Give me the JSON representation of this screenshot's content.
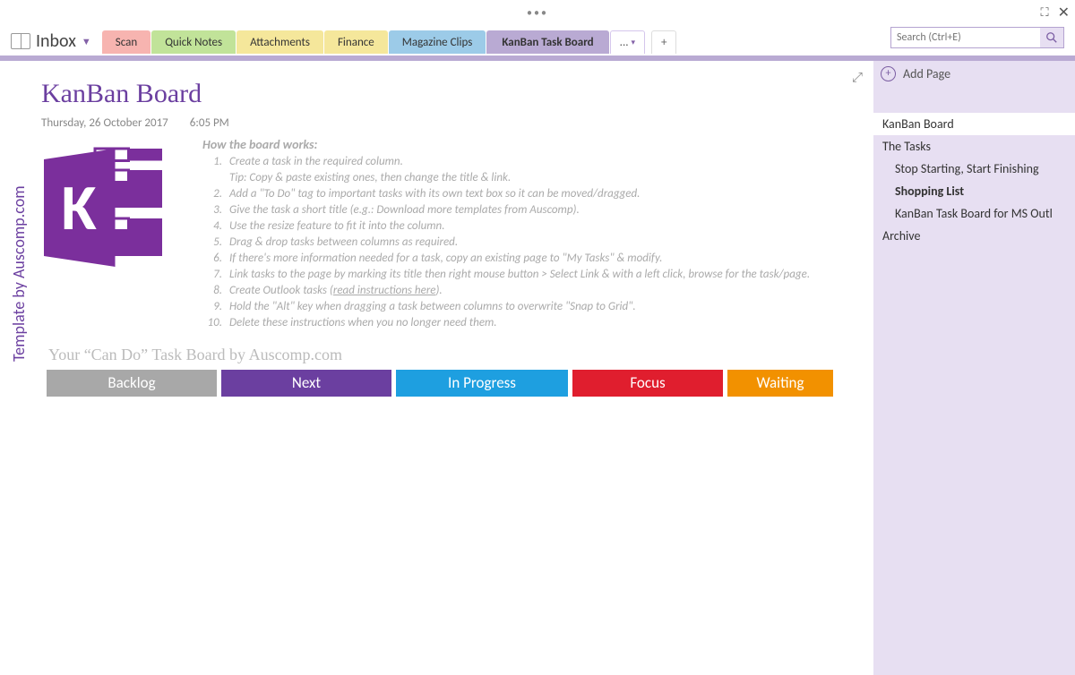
{
  "titlebar": {
    "dots": "•••"
  },
  "notebook": {
    "name": "Inbox"
  },
  "tabs": {
    "scan": "Scan",
    "quicknotes": "Quick Notes",
    "attachments": "Attachments",
    "finance": "Finance",
    "magazine": "Magazine Clips",
    "kanban": "KanBan Task Board",
    "more": "...",
    "new": "+"
  },
  "search": {
    "placeholder": "Search (Ctrl+E)"
  },
  "side_credit": "Template by Auscomp.com",
  "page": {
    "title": "KanBan Board",
    "date": "Thursday, 26 October 2017",
    "time": "6:05 PM"
  },
  "how_works": {
    "title": "How the board works:",
    "items": [
      "Create a task in the required column.",
      "Add a \"To Do\" tag to important tasks with its own text box so it can be moved/dragged.",
      "Give the task a short title (e.g.: Download more templates from Auscomp).",
      "Use the resize feature to fit it into the column.",
      "Drag & drop tasks between columns as required.",
      "If there's more information needed for a task, copy an existing page to \"My Tasks\" & modify.",
      "Link tasks to the page by marking its title then right mouse button > Select Link & with a left click, browse for the task/page.",
      "Create Outlook tasks (",
      "Hold the \"Alt\" key when dragging a task between columns to overwrite \"Snap to Grid\".",
      "Delete these instructions when you no longer need them."
    ],
    "tip": "Tip: Copy & paste existing ones, then change the title & link.",
    "read_link": "read instructions here",
    "paren_close": ")."
  },
  "board": {
    "caption": "Your “Can Do” Task Board by Auscomp.com",
    "cols": [
      "Backlog",
      "Next",
      "In Progress",
      "Focus",
      "Waiting"
    ]
  },
  "addpage": "Add Page",
  "pages": {
    "p1": "KanBan Board",
    "p2": "The Tasks",
    "p3": "Stop Starting, Start Finishing",
    "p4": "Shopping List",
    "p5": "KanBan Task Board for MS Outl",
    "p6": "Archive"
  }
}
